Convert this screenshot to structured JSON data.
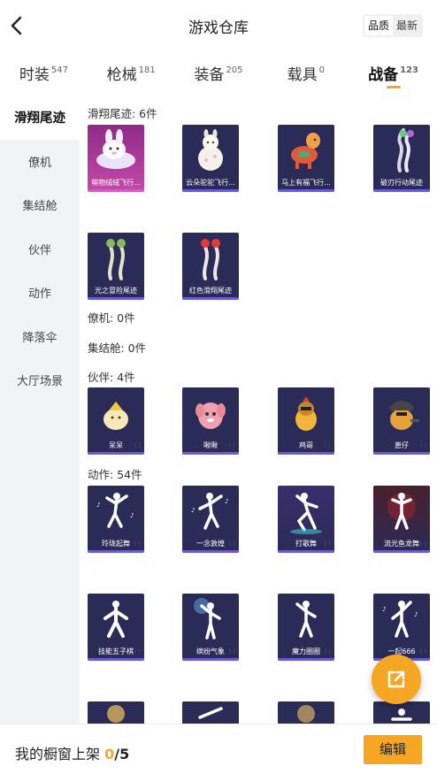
{
  "header": {
    "title": "游戏仓库",
    "sort_options": [
      "品质",
      "最新"
    ]
  },
  "tabs": [
    {
      "label": "时装",
      "count": "547"
    },
    {
      "label": "枪械",
      "count": "181"
    },
    {
      "label": "装备",
      "count": "205"
    },
    {
      "label": "载具",
      "count": "0"
    },
    {
      "label": "战备",
      "count": "123"
    }
  ],
  "sidebar": [
    "滑翔尾迹",
    "僚机",
    "集结舱",
    "伙伴",
    "动作",
    "降落伞",
    "大厅场景"
  ],
  "sections": {
    "glide": {
      "title": "滑翔尾迹: 6件",
      "items": [
        "萌物绒绒飞行...",
        "云朵驼驼飞行...",
        "马上有福飞行...",
        "破刃行动尾迹",
        "光之冒险尾迹",
        "红色滑翔尾迹"
      ]
    },
    "wingman": {
      "title": "僚机: 0件"
    },
    "capsule": {
      "title": "集结舱: 0件"
    },
    "partner": {
      "title": "伙伴: 4件",
      "items": [
        "呆呆",
        "啾啾",
        "鸡哥",
        "崽仔"
      ]
    },
    "emote": {
      "title": "动作: 54件",
      "items": [
        "玲珑起舞",
        "一念敦煌",
        "打歌舞",
        "流光鱼龙舞",
        "技能五子棋",
        "缤纷气象",
        "魔力圈圈",
        "一起666"
      ]
    }
  },
  "bottom": {
    "shelf_label": "我的橱窗上架",
    "shelf_count": "0",
    "shelf_total": "/5",
    "edit": "编辑"
  },
  "colors": {
    "accent": "#f5a623",
    "card_bg": "#2a2b56"
  },
  "icons": {
    "back": "chevron-left-icon",
    "fab": "share-out-icon"
  }
}
